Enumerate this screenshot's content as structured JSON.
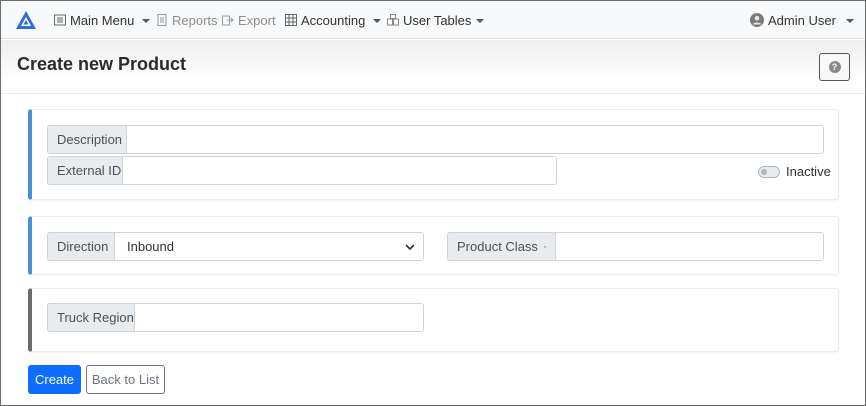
{
  "navbar": {
    "main_menu": "Main Menu",
    "reports": "Reports",
    "export": "Export",
    "accounting": "Accounting",
    "user_tables": "User Tables",
    "user": "Admin User"
  },
  "colors": {
    "accent": "#4a90d9",
    "primary_button": "#0d6efd",
    "logo": "#2f6fd6"
  },
  "page": {
    "title": "Create new Product",
    "help_label": "?"
  },
  "form": {
    "description_label": "Description",
    "description_value": "",
    "external_id_label": "External ID",
    "external_id_value": "",
    "inactive_label": "Inactive",
    "inactive_checked": false,
    "direction_label": "Direction",
    "direction_value": "Inbound",
    "product_class_label": "Product Class",
    "product_class_value": "",
    "truck_region_label": "Truck Region",
    "truck_region_value": ""
  },
  "actions": {
    "create": "Create",
    "back": "Back to List"
  },
  "icons": {
    "logo": "triangle-logo-icon",
    "main_menu": "list-icon",
    "reports": "document-icon",
    "export": "export-icon",
    "accounting": "grid-icon",
    "user_tables": "tables-icon",
    "user": "user-avatar-icon",
    "help": "question-icon",
    "product_class_link": "external-link-icon"
  }
}
